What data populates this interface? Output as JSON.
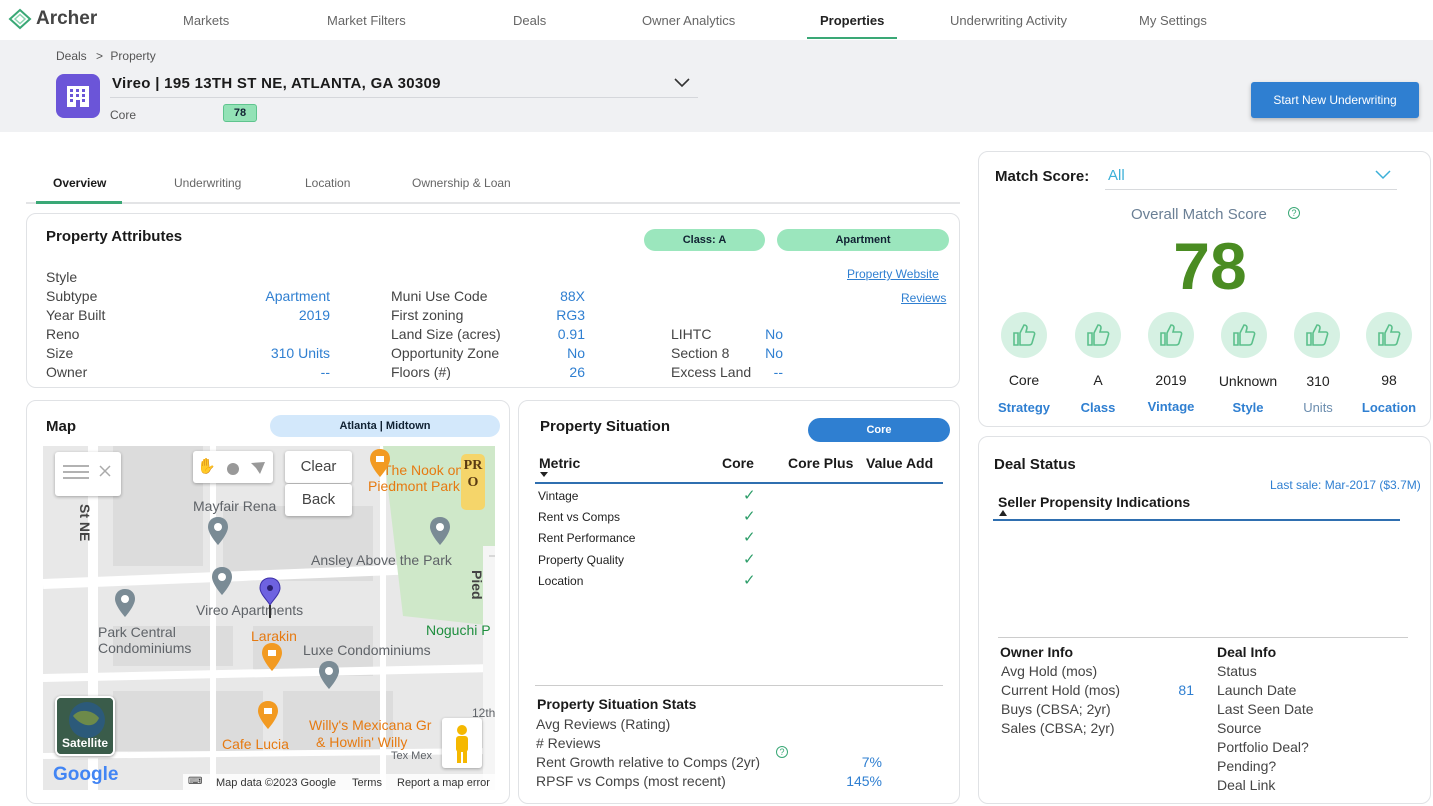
{
  "app": {
    "name": "Archer"
  },
  "nav": [
    "Markets",
    "Market Filters",
    "Deals",
    "Owner Analytics",
    "Properties",
    "Underwriting Activity",
    "My Settings"
  ],
  "breadcrumb": {
    "root": "Deals",
    "sep": ">",
    "current": "Property"
  },
  "property": {
    "title": "Vireo | 195 13TH ST NE, ATLANTA, GA 30309",
    "strategy": "Core",
    "score": "78"
  },
  "actions": {
    "start_underwriting": "Start New Underwriting"
  },
  "tabs": [
    "Overview",
    "Underwriting",
    "Location",
    "Ownership & Loan"
  ],
  "attributes": {
    "title": "Property Attributes",
    "class_pill": "Class: A",
    "type_pill": "Apartment",
    "website_link": "Property Website",
    "reviews_link": "Reviews",
    "col1": [
      {
        "label": "Style",
        "value": ""
      },
      {
        "label": "Subtype",
        "value": "Apartment"
      },
      {
        "label": "Year Built",
        "value": "2019"
      },
      {
        "label": "Reno",
        "value": ""
      },
      {
        "label": "Size",
        "value": "310 Units"
      },
      {
        "label": "Owner",
        "value": "--"
      }
    ],
    "col2": [
      {
        "label": "Muni Use Code",
        "value": "88X"
      },
      {
        "label": "First zoning",
        "value": "RG3"
      },
      {
        "label": "Land Size (acres)",
        "value": "0.91"
      },
      {
        "label": "Opportunity Zone",
        "value": "No"
      },
      {
        "label": "Floors (#)",
        "value": "26"
      }
    ],
    "col3": [
      {
        "label": "LIHTC",
        "value": "No"
      },
      {
        "label": "Section 8",
        "value": "No"
      },
      {
        "label": "Excess Land",
        "value": "--"
      }
    ]
  },
  "map": {
    "title": "Map",
    "market_pill": "Atlanta | Midtown",
    "clear": "Clear",
    "back": "Back",
    "satellite": "Satellite",
    "google": "Google",
    "footer": {
      "data": "Map data ©2023 Google",
      "terms": "Terms",
      "report": "Report a map error"
    },
    "labels": {
      "nook": "The Nook on",
      "piedmont": "Piedmont Park",
      "mayfair": "Mayfair Rena",
      "ansley": "Ansley Above the Park",
      "vireo": "Vireo Apartments",
      "park_central": "Park Central",
      "condos": "Condominiums",
      "larakin": "Larakin",
      "noguchi": "Noguchi P",
      "luxe": "Luxe Condominiums",
      "willys": "Willy's Mexicana Gr",
      "howlin": "& Howlin' Willy",
      "texmex": "Tex Mex",
      "cafe_lucia": "Cafe Lucia",
      "st_ne": "St NE",
      "piedmont_rd": "Pied",
      "twelfth": "12th",
      "pro": "PRO"
    }
  },
  "situation": {
    "title": "Property Situation",
    "pill": "Core",
    "headers": [
      "Metric",
      "Core",
      "Core Plus",
      "Value Add"
    ],
    "rows": [
      "Vintage",
      "Rent vs Comps",
      "Rent Performance",
      "Property Quality",
      "Location"
    ],
    "check": "✓",
    "stats_title": "Property Situation Stats",
    "stats": [
      {
        "label": "Avg Reviews (Rating)",
        "value": ""
      },
      {
        "label": "# Reviews",
        "value": ""
      },
      {
        "label": "Rent Growth relative to Comps (2yr)",
        "value": "7%"
      },
      {
        "label": "RPSF vs Comps (most recent)",
        "value": "145%"
      }
    ]
  },
  "match": {
    "label": "Match Score:",
    "filter": "All",
    "overall_label": "Overall Match Score",
    "overall": "78",
    "accent": "#4a8c22",
    "categories": [
      {
        "value": "Core",
        "label": "Strategy"
      },
      {
        "value": "A",
        "label": "Class"
      },
      {
        "value": "2019",
        "label": "Vintage"
      },
      {
        "value": "Unknown",
        "label": "Style"
      },
      {
        "value": "310",
        "label": "Units"
      },
      {
        "value": "98",
        "label": "Location"
      }
    ]
  },
  "deal_status": {
    "title": "Deal Status",
    "last_sale": "Last sale: Mar-2017 ($3.7M)",
    "seller_heading": "Seller Propensity Indications",
    "owner_info": {
      "title": "Owner Info",
      "rows": [
        {
          "label": "Avg Hold (mos)",
          "value": ""
        },
        {
          "label": "Current Hold (mos)",
          "value": "81"
        },
        {
          "label": "Buys (CBSA; 2yr)",
          "value": ""
        },
        {
          "label": "Sales (CBSA; 2yr)",
          "value": ""
        }
      ]
    },
    "deal_info": {
      "title": "Deal Info",
      "rows": [
        "Status",
        "Launch Date",
        "Last Seen Date",
        "Source",
        "Portfolio Deal?",
        "Pending?",
        "Deal Link"
      ]
    }
  }
}
